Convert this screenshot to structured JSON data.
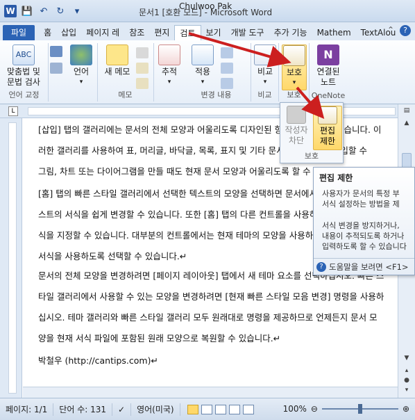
{
  "window": {
    "title": "문서1 [호환 모드] - Microsoft Word",
    "author": "Chulwoo Pak"
  },
  "qat": {
    "icons": [
      "word-logo-icon",
      "save-icon",
      "undo-icon",
      "redo-icon",
      "customize-icon"
    ]
  },
  "tabs": {
    "file": "파일",
    "items": [
      "홈",
      "삽입",
      "페이지 레",
      "참조",
      "편지",
      "검토",
      "보기",
      "개발 도구",
      "추가 기능",
      "Mathem",
      "TextAlou"
    ],
    "active_index": 5
  },
  "ribbon": {
    "proofing": {
      "label": "언어 교정",
      "spelling": "맞춤법 및\n문법 검사"
    },
    "language": {
      "label": "언어"
    },
    "comments": {
      "label": "메모",
      "new_comment": "새 메모"
    },
    "tracking": {
      "label": "변경 내용",
      "track": "추적",
      "accept": "적용"
    },
    "compare": {
      "label": "비교",
      "compare": "비교"
    },
    "protect": {
      "label": "보호",
      "protect": "보호"
    },
    "onenote": {
      "label": "OneNote",
      "linked_notes": "연결된\n노트"
    }
  },
  "protect_popup": {
    "block_authors": "작성자\n차단",
    "restrict_editing": "편집\n제한",
    "label": "보호"
  },
  "tooltip": {
    "title": "편집 제한",
    "line1": "사용자가 문서의 특정 부",
    "line2": "서식 설정하는 방법을 제",
    "line3": "서식 변경을 방지하거나,",
    "line4": "내용이 추적되도록 하거나",
    "line5": "입력하도록 할 수 있습니다",
    "help": "도움말을 보려면 <F1>"
  },
  "document": {
    "p1": [
      "[삽입] 탭의 갤러리에는 문서의 전체 모양과 어울리도록 디자인된 항목이 포함되어 있습니다. 이",
      "러한 갤러리를 사용하여 표, 머리글, 바닥글, 목록, 표지 및 기타 문서 구성 요소를 삽입할 수",
      "그림, 차트 또는 다이어그램을 만들 때도 현재 문서 모양과 어울리도록 할 수 있습니다."
    ],
    "p2": [
      "[홈] 탭의 빠른 스타일 갤러리에서 선택한 텍스트의 모양을 선택하면 문서에서 선택한 텍",
      "스트의 서식을 쉽게 변경할 수 있습니다. 또한 [홈] 탭의 다른 컨트롤을 사용하여 텍스트의 서",
      "식을 지정할 수 있습니다. 대부분의 컨트롤에서는 현재 테마의 모양을 사용하거나 직접 지정한",
      "서식을 사용하도록 선택할 수 있습니다.↵"
    ],
    "p3": [
      "문서의 전체 모양을 변경하려면 [페이지 레이아웃] 탭에서 새 테마 요소를 선택하십시오. 빠른 스",
      "타일 갤러리에서 사용할 수 있는 모양을 변경하려면 [현재 빠른 스타일 모음 변경] 명령을 사용하",
      "십시오. 테마 갤러리와 빠른 스타일 갤러리 모두 원래대로 명령을 제공하므로 언제든지 문서 모",
      "양을 현재 서식 파일에 포함된 원래 모양으로 복원할 수 있습니다.↵"
    ],
    "signature": "박철우 (http://cantips.com)↵"
  },
  "status": {
    "page": "페이지: 1/1",
    "words": "단어 수: 131",
    "lang": "영어(미국)",
    "zoom": "100%",
    "zoom_level": 100
  },
  "colors": {
    "accent": "#2b63b5",
    "arrow": "#cc1f1f"
  }
}
